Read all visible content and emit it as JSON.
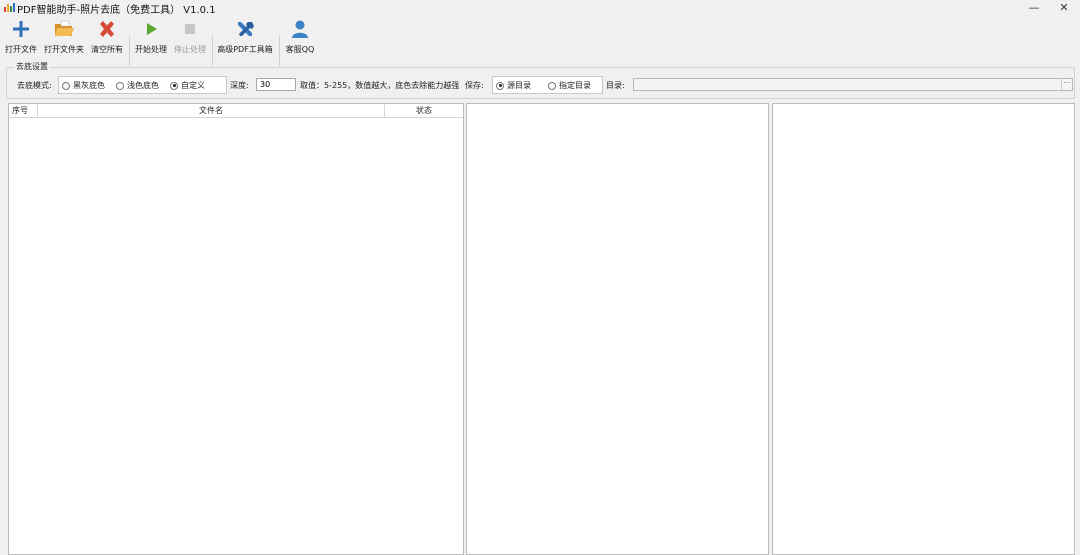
{
  "window": {
    "title": "PDF智能助手-照片去底（免费工具） V1.0.1",
    "minimize_glyph": "—",
    "close_glyph": "✕"
  },
  "toolbar": {
    "open_file": "打开文件",
    "open_folder": "打开文件夹",
    "clear_all": "清空所有",
    "start": "开始处理",
    "stop": "停止处理",
    "advanced": "高级PDF工具箱",
    "support": "客服QQ"
  },
  "icons": {
    "open_file": "plus-icon",
    "open_folder": "folder-icon",
    "clear_all": "x-icon",
    "start": "play-icon",
    "stop": "stop-icon",
    "advanced": "tools-icon",
    "support": "user-icon"
  },
  "colors": {
    "plus": "#2f6fba",
    "folder": "#e8a531",
    "clear": "#d84a3a",
    "play": "#5aa830",
    "stop_disabled": "#c6c6c6",
    "tools": "#3a78c2",
    "user": "#3b82c6"
  },
  "settings": {
    "group_title": "去底设置",
    "mode_label": "去底模式:",
    "mode_options": [
      "黑灰底色",
      "浅色底色",
      "自定义"
    ],
    "mode_selected": "自定义",
    "depth_label": "深度:",
    "depth_value": "30",
    "range_hint": "取值：5-255，数值越大，底色去除能力越强",
    "save_label": "保存:",
    "save_options": [
      "源目录",
      "指定目录"
    ],
    "save_selected": "源目录",
    "dir_label": "目录:",
    "dir_value": "",
    "browse_glyph": "···"
  },
  "file_list": {
    "columns": [
      "序号",
      "文件名",
      "状态"
    ],
    "rows": []
  }
}
